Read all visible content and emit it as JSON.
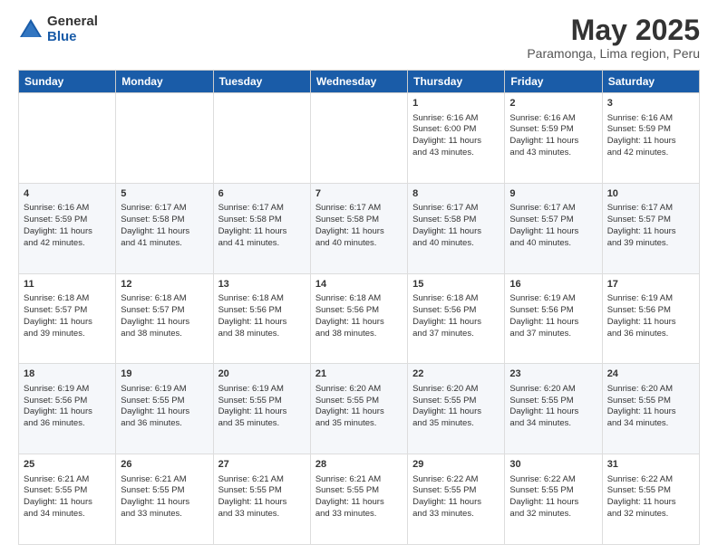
{
  "logo": {
    "general": "General",
    "blue": "Blue"
  },
  "header": {
    "month": "May 2025",
    "location": "Paramonga, Lima region, Peru"
  },
  "weekdays": [
    "Sunday",
    "Monday",
    "Tuesday",
    "Wednesday",
    "Thursday",
    "Friday",
    "Saturday"
  ],
  "weeks": [
    [
      {
        "day": "",
        "content": ""
      },
      {
        "day": "",
        "content": ""
      },
      {
        "day": "",
        "content": ""
      },
      {
        "day": "",
        "content": ""
      },
      {
        "day": "1",
        "content": "Sunrise: 6:16 AM\nSunset: 6:00 PM\nDaylight: 11 hours\nand 43 minutes."
      },
      {
        "day": "2",
        "content": "Sunrise: 6:16 AM\nSunset: 5:59 PM\nDaylight: 11 hours\nand 43 minutes."
      },
      {
        "day": "3",
        "content": "Sunrise: 6:16 AM\nSunset: 5:59 PM\nDaylight: 11 hours\nand 42 minutes."
      }
    ],
    [
      {
        "day": "4",
        "content": "Sunrise: 6:16 AM\nSunset: 5:59 PM\nDaylight: 11 hours\nand 42 minutes."
      },
      {
        "day": "5",
        "content": "Sunrise: 6:17 AM\nSunset: 5:58 PM\nDaylight: 11 hours\nand 41 minutes."
      },
      {
        "day": "6",
        "content": "Sunrise: 6:17 AM\nSunset: 5:58 PM\nDaylight: 11 hours\nand 41 minutes."
      },
      {
        "day": "7",
        "content": "Sunrise: 6:17 AM\nSunset: 5:58 PM\nDaylight: 11 hours\nand 40 minutes."
      },
      {
        "day": "8",
        "content": "Sunrise: 6:17 AM\nSunset: 5:58 PM\nDaylight: 11 hours\nand 40 minutes."
      },
      {
        "day": "9",
        "content": "Sunrise: 6:17 AM\nSunset: 5:57 PM\nDaylight: 11 hours\nand 40 minutes."
      },
      {
        "day": "10",
        "content": "Sunrise: 6:17 AM\nSunset: 5:57 PM\nDaylight: 11 hours\nand 39 minutes."
      }
    ],
    [
      {
        "day": "11",
        "content": "Sunrise: 6:18 AM\nSunset: 5:57 PM\nDaylight: 11 hours\nand 39 minutes."
      },
      {
        "day": "12",
        "content": "Sunrise: 6:18 AM\nSunset: 5:57 PM\nDaylight: 11 hours\nand 38 minutes."
      },
      {
        "day": "13",
        "content": "Sunrise: 6:18 AM\nSunset: 5:56 PM\nDaylight: 11 hours\nand 38 minutes."
      },
      {
        "day": "14",
        "content": "Sunrise: 6:18 AM\nSunset: 5:56 PM\nDaylight: 11 hours\nand 38 minutes."
      },
      {
        "day": "15",
        "content": "Sunrise: 6:18 AM\nSunset: 5:56 PM\nDaylight: 11 hours\nand 37 minutes."
      },
      {
        "day": "16",
        "content": "Sunrise: 6:19 AM\nSunset: 5:56 PM\nDaylight: 11 hours\nand 37 minutes."
      },
      {
        "day": "17",
        "content": "Sunrise: 6:19 AM\nSunset: 5:56 PM\nDaylight: 11 hours\nand 36 minutes."
      }
    ],
    [
      {
        "day": "18",
        "content": "Sunrise: 6:19 AM\nSunset: 5:56 PM\nDaylight: 11 hours\nand 36 minutes."
      },
      {
        "day": "19",
        "content": "Sunrise: 6:19 AM\nSunset: 5:55 PM\nDaylight: 11 hours\nand 36 minutes."
      },
      {
        "day": "20",
        "content": "Sunrise: 6:19 AM\nSunset: 5:55 PM\nDaylight: 11 hours\nand 35 minutes."
      },
      {
        "day": "21",
        "content": "Sunrise: 6:20 AM\nSunset: 5:55 PM\nDaylight: 11 hours\nand 35 minutes."
      },
      {
        "day": "22",
        "content": "Sunrise: 6:20 AM\nSunset: 5:55 PM\nDaylight: 11 hours\nand 35 minutes."
      },
      {
        "day": "23",
        "content": "Sunrise: 6:20 AM\nSunset: 5:55 PM\nDaylight: 11 hours\nand 34 minutes."
      },
      {
        "day": "24",
        "content": "Sunrise: 6:20 AM\nSunset: 5:55 PM\nDaylight: 11 hours\nand 34 minutes."
      }
    ],
    [
      {
        "day": "25",
        "content": "Sunrise: 6:21 AM\nSunset: 5:55 PM\nDaylight: 11 hours\nand 34 minutes."
      },
      {
        "day": "26",
        "content": "Sunrise: 6:21 AM\nSunset: 5:55 PM\nDaylight: 11 hours\nand 33 minutes."
      },
      {
        "day": "27",
        "content": "Sunrise: 6:21 AM\nSunset: 5:55 PM\nDaylight: 11 hours\nand 33 minutes."
      },
      {
        "day": "28",
        "content": "Sunrise: 6:21 AM\nSunset: 5:55 PM\nDaylight: 11 hours\nand 33 minutes."
      },
      {
        "day": "29",
        "content": "Sunrise: 6:22 AM\nSunset: 5:55 PM\nDaylight: 11 hours\nand 33 minutes."
      },
      {
        "day": "30",
        "content": "Sunrise: 6:22 AM\nSunset: 5:55 PM\nDaylight: 11 hours\nand 32 minutes."
      },
      {
        "day": "31",
        "content": "Sunrise: 6:22 AM\nSunset: 5:55 PM\nDaylight: 11 hours\nand 32 minutes."
      }
    ]
  ]
}
